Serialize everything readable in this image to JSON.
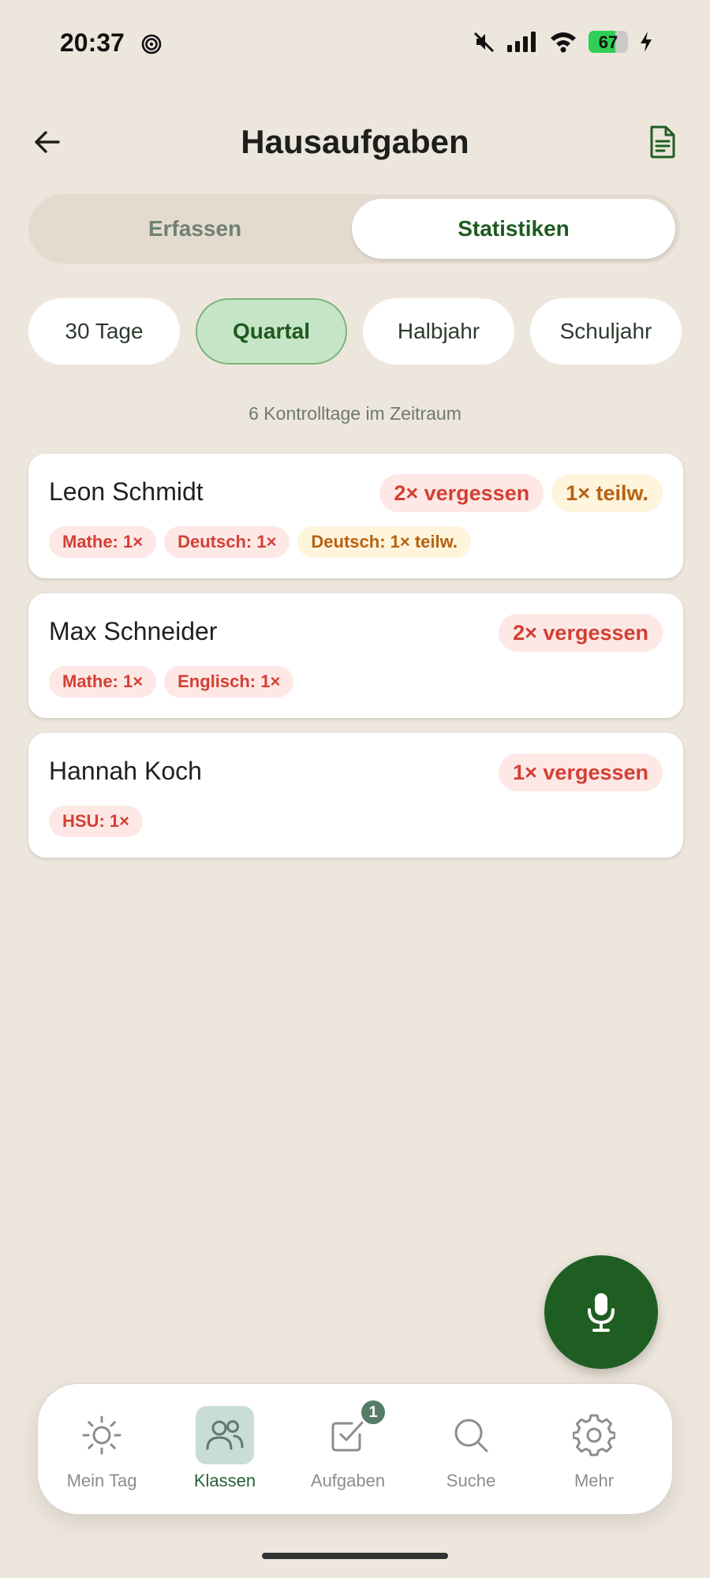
{
  "status_bar": {
    "time": "20:37",
    "battery": "67",
    "battery_level": 0.67,
    "icons": [
      "spiral-icon",
      "mute-icon",
      "signal-icon",
      "wifi-icon",
      "battery-icon",
      "charging-icon"
    ]
  },
  "header": {
    "title": "Hausaufgaben",
    "back_icon": "arrow-left-icon",
    "action_icon": "document-icon"
  },
  "tabs": [
    {
      "label": "Erfassen",
      "active": false
    },
    {
      "label": "Statistiken",
      "active": true
    }
  ],
  "periods": [
    {
      "label": "30 Tage",
      "active": false
    },
    {
      "label": "Quartal",
      "active": true
    },
    {
      "label": "Halbjahr",
      "active": false
    },
    {
      "label": "Schuljahr",
      "active": false
    }
  ],
  "period_info": "6 Kontrolltage im Zeitraum",
  "students": [
    {
      "name": "Leon Schmidt",
      "badges": [
        "2× vergessen",
        "1× teilw."
      ],
      "tags": [
        "Mathe: 1×",
        "Deutsch: 1×",
        "Deutsch: 1× teilw."
      ]
    },
    {
      "name": "Max Schneider",
      "badges": [
        "2× vergessen"
      ],
      "tags": [
        "Mathe: 1×",
        "Englisch: 1×"
      ]
    },
    {
      "name": "Hannah Koch",
      "badges": [
        "1× vergessen"
      ],
      "tags": [
        "HSU: 1×"
      ]
    }
  ],
  "fab": {
    "icon": "microphone-icon"
  },
  "bottom_nav": [
    {
      "label": "Mein Tag",
      "icon": "sun-icon",
      "active": false
    },
    {
      "label": "Klassen",
      "icon": "users-icon",
      "active": true
    },
    {
      "label": "Aufgaben",
      "icon": "checkbox-icon",
      "active": false,
      "badge": "1"
    },
    {
      "label": "Suche",
      "icon": "search-icon",
      "active": false
    },
    {
      "label": "Mehr",
      "icon": "gear-icon",
      "active": false
    }
  ],
  "colors": {
    "background": "#ede6dc",
    "primary_green": "#1f5e22",
    "active_chip": "#c6e5c6",
    "forgotten_red": "#d43f33",
    "partial_amber": "#b66212"
  }
}
